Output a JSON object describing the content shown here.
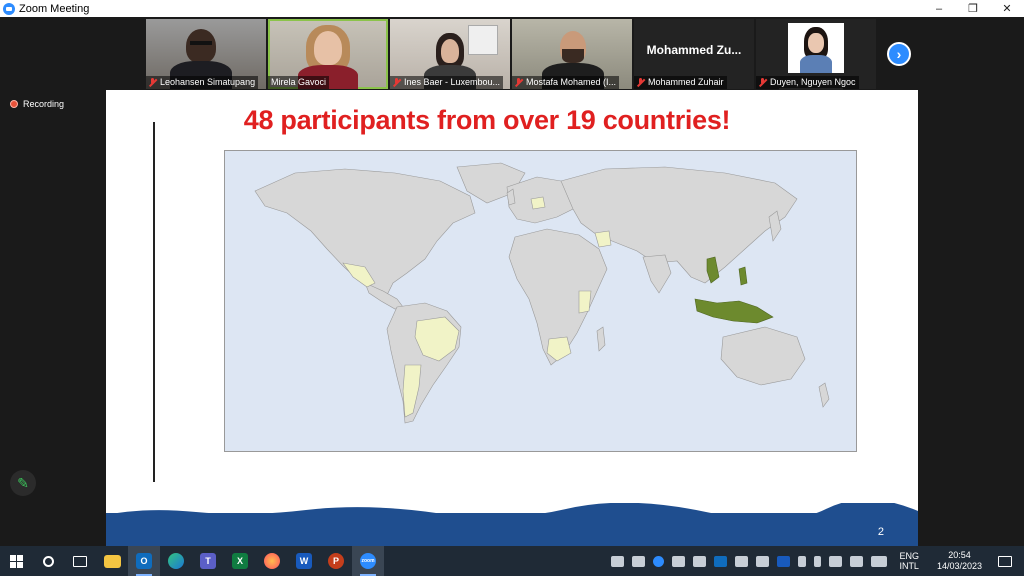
{
  "window": {
    "title": "Zoom Meeting",
    "minimize": "–",
    "restore": "❐",
    "close": "✕"
  },
  "participants": [
    {
      "name": "Leohansen Simatupang",
      "muted": true,
      "type": "video"
    },
    {
      "name": "Mirela Gavoci",
      "muted": false,
      "type": "video",
      "active": true
    },
    {
      "name": "Ines Baer - Luxembou...",
      "muted": true,
      "type": "video"
    },
    {
      "name": "Mostafa Mohamed (I...",
      "muted": true,
      "type": "video"
    },
    {
      "name": "Mohammed Zuhair",
      "muted": true,
      "type": "text",
      "display": "Mohammed  Zu..."
    },
    {
      "name": "Duyen, Nguyen Ngoc",
      "muted": true,
      "type": "photo"
    }
  ],
  "recording": {
    "label": "Recording"
  },
  "slide": {
    "heading": "48 participants from over 19 countries!",
    "page_number": "2"
  },
  "colors": {
    "accent": "#2D8CFF",
    "heading": "#e02020",
    "map_ocean": "#dde6f3",
    "land": "#d7d7d7",
    "highlight_light": "#f1f3c7",
    "highlight_dark": "#6d8a2e",
    "band": "#1f4e8f"
  },
  "taskbar": {
    "apps": [
      "windows-start",
      "search",
      "task-view",
      "file-explorer",
      "outlook",
      "edge",
      "teams",
      "excel",
      "firefox",
      "word",
      "powerpoint",
      "zoom"
    ],
    "language": {
      "line1": "ENG",
      "line2": "INTL"
    },
    "time": "20:54",
    "date": "14/03/2023"
  }
}
